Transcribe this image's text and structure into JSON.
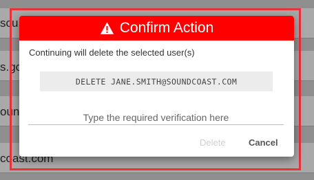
{
  "background": {
    "rows": [
      {
        "text": "scu"
      },
      {
        "text": "s.go"
      },
      {
        "text": "oun"
      },
      {
        "text": "coast.com"
      }
    ]
  },
  "dialog": {
    "title": "Confirm Action",
    "header_icon": "warning-triangle-icon",
    "header_color": "#ff0000",
    "message": "Continuing will delete the selected user(s)",
    "verification_phrase": "DELETE JANE.SMITH@SOUNDCOAST.COM",
    "input": {
      "placeholder": "Type the required verification here",
      "value": ""
    },
    "buttons": {
      "delete_label": "Delete",
      "delete_disabled": true,
      "cancel_label": "Cancel"
    }
  },
  "highlight_color": "#e8323c"
}
